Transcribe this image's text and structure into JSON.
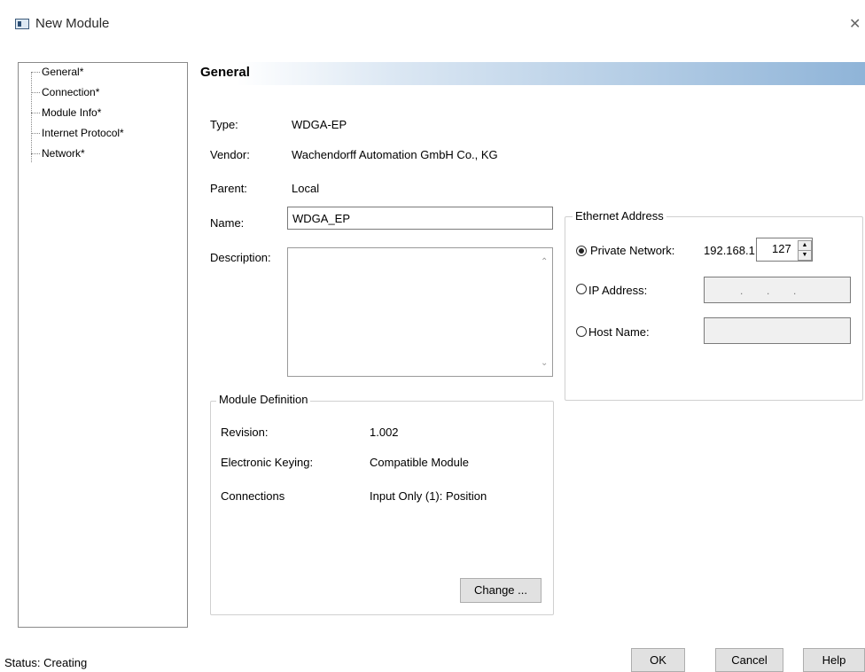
{
  "window": {
    "title": "New Module",
    "close_glyph": "✕"
  },
  "tree": {
    "items": [
      {
        "label": "General*"
      },
      {
        "label": "Connection*"
      },
      {
        "label": "Module Info*"
      },
      {
        "label": "Internet Protocol*"
      },
      {
        "label": "Network*"
      }
    ]
  },
  "panel": {
    "title": "General"
  },
  "fields": {
    "type_label": "Type:",
    "type_value": "WDGA-EP",
    "vendor_label": "Vendor:",
    "vendor_value": "Wachendorff Automation GmbH  Co., KG",
    "parent_label": "Parent:",
    "parent_value": "Local",
    "name_label": "Name:",
    "name_value": "WDGA_EP",
    "description_label": "Description:",
    "description_value": ""
  },
  "ethernet": {
    "group_title": "Ethernet Address",
    "private_label": "Private Network:",
    "private_prefix": "192.168.1.",
    "private_last_octet": "127",
    "ip_label": "IP Address:",
    "ip_placeholder": ".        .        .",
    "host_label": "Host Name:",
    "selected": "private"
  },
  "module_definition": {
    "group_title": "Module Definition",
    "revision_label": "Revision:",
    "revision_value": "1.002",
    "keying_label": "Electronic Keying:",
    "keying_value": "Compatible Module",
    "connections_label": "Connections",
    "connections_value": "Input Only (1): Position",
    "change_button": "Change ..."
  },
  "footer": {
    "status": "Status:  Creating",
    "ok": "OK",
    "cancel": "Cancel",
    "help": "Help"
  }
}
